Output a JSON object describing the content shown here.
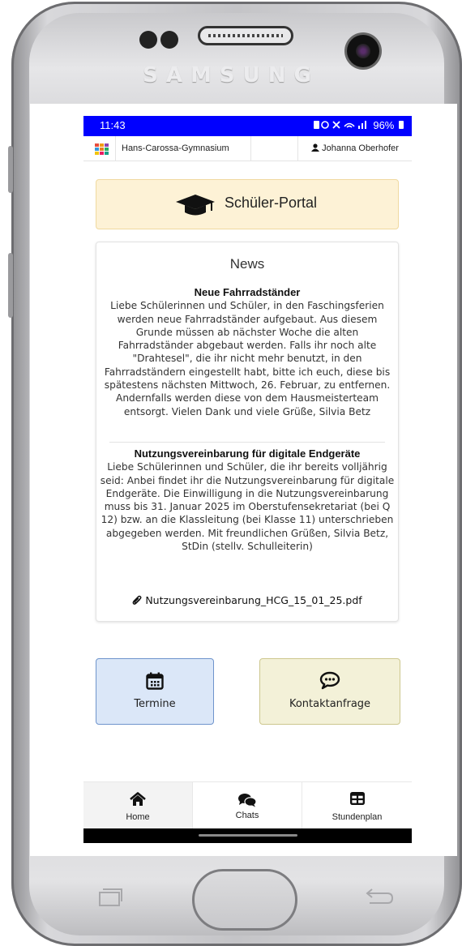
{
  "device": {
    "brand": "SAMSUNG"
  },
  "status_bar": {
    "time": "11:43",
    "battery": "96%"
  },
  "app_bar": {
    "school": "Hans-Carossa-Gymnasium",
    "user": "Johanna Oberhofer",
    "grid_colors": [
      "#e74c3c",
      "#f39c12",
      "#8e44ad",
      "#3498db",
      "#e67e22",
      "#27ae60",
      "#f1c40f",
      "#e91e63",
      "#16a085"
    ]
  },
  "portal": {
    "title": "Schüler-Portal",
    "icon": "graduation-cap-icon"
  },
  "news": {
    "heading": "News",
    "items": [
      {
        "title": "Neue Fahrradständer",
        "body": "Liebe Schülerinnen und Schüler, in den Faschingsferien werden neue Fahrradständer aufgebaut. Aus diesem Grunde müssen ab nächster Woche die alten Fahrradständer abgebaut werden. Falls ihr noch alte \"Drahtesel\", die ihr nicht mehr benutzt, in den Fahrradständern eingestellt habt, bitte ich euch, diese bis spätestens nächsten Mittwoch, 26. Februar, zu entfernen. Andernfalls werden diese von dem Hausmeisterteam entsorgt. Vielen Dank und viele Grüße, Silvia Betz"
      },
      {
        "title": "Nutzungsvereinbarung für digitale Endgeräte",
        "body": "Liebe Schülerinnen und Schüler, die ihr bereits volljährig seid: Anbei findet ihr die Nutzungsvereinbarung für digitale Endgeräte. Die Einwilligung in die Nutzungsvereinbarung muss bis 31. Januar 2025 im Oberstufensekretariat (bei Q 12) bzw. an die Klassleitung (bei Klasse 11) unterschrieben abgegeben werden. Mit freundlichen Grüßen, Silvia Betz, StDin (stellv. Schulleiterin)"
      }
    ],
    "attachment": "Nutzungsvereinbarung_HCG_15_01_25.pdf"
  },
  "tiles": [
    {
      "label": "Termine",
      "icon": "calendar-icon"
    },
    {
      "label": "Kontaktanfrage",
      "icon": "chat-bubble-icon"
    }
  ],
  "bottom_nav": [
    {
      "label": "Home",
      "icon": "home-icon",
      "active": true
    },
    {
      "label": "Chats",
      "icon": "chats-icon"
    },
    {
      "label": "Stundenplan",
      "icon": "table-icon"
    }
  ]
}
